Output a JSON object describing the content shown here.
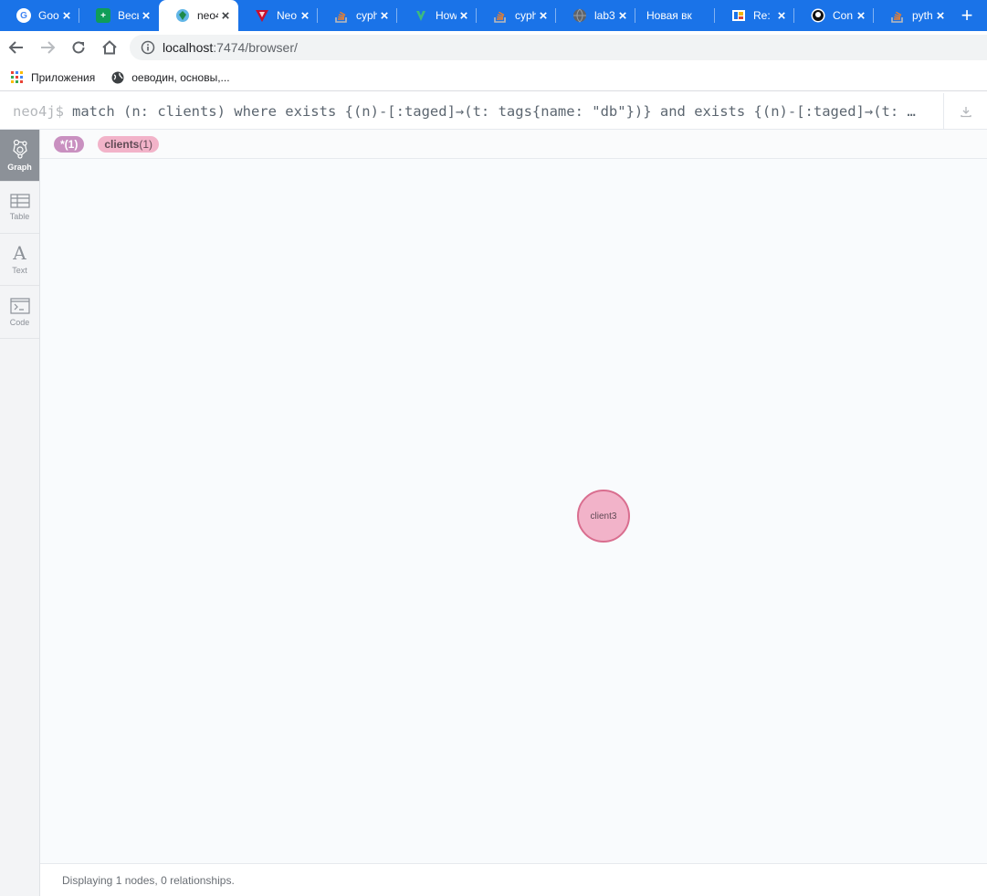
{
  "tabs": [
    {
      "title": "Goo",
      "favicon": "google-icon",
      "color": "#ffffff",
      "fg": "#4285f4",
      "glyph": "G"
    },
    {
      "title": "Весь",
      "favicon": "green-plus-icon",
      "color": "#0f9d58",
      "fg": "#ffffff",
      "glyph": "+"
    },
    {
      "title": "neo4",
      "favicon": "neo4j-browser-icon",
      "color": "#62b6e7",
      "fg": "#1e6b3a",
      "glyph": "◆",
      "active": true
    },
    {
      "title": "Neo",
      "favicon": "neo4j-triangle-icon",
      "color": "#c8102e",
      "fg": "#ffffff",
      "glyph": "▼"
    },
    {
      "title": "cyph",
      "favicon": "stackoverflow-icon",
      "color": "#f48024",
      "fg": "#ffffff",
      "glyph": "≡"
    },
    {
      "title": "How",
      "favicon": "green-leaf-icon",
      "color": "#3dba7e",
      "fg": "#ffffff",
      "glyph": "✓"
    },
    {
      "title": "cyph",
      "favicon": "stackoverflow-icon",
      "color": "#f48024",
      "fg": "#ffffff",
      "glyph": "≡"
    },
    {
      "title": "lab3",
      "favicon": "globe-icon",
      "color": "#5f6368",
      "fg": "#ffffff",
      "glyph": "◍"
    },
    {
      "title": "Новая вк",
      "favicon": "",
      "color": "",
      "fg": "",
      "glyph": ""
    },
    {
      "title": "Re: I",
      "favicon": "mail-icon",
      "color": "#ffffff",
      "fg": "#1a73e8",
      "glyph": "✉"
    },
    {
      "title": "Con",
      "favicon": "github-icon",
      "color": "#ffffff",
      "fg": "#000000",
      "glyph": "●"
    },
    {
      "title": "pyth",
      "favicon": "stackoverflow-icon",
      "color": "#f48024",
      "fg": "#ffffff",
      "glyph": "≡"
    }
  ],
  "address": {
    "host": "localhost",
    "path": ":7474/browser/"
  },
  "bookmarks": [
    {
      "label": "Приложения",
      "icon": "apps-grid-icon"
    },
    {
      "label": "оеводин, основы,...",
      "icon": "globe-icon"
    }
  ],
  "editor": {
    "prompt": "neo4j$",
    "query": "match (n: clients) where exists {(n)-[:taged]→(t: tags{name: \"db\"})} and exists {(n)-[:taged]→(t: …"
  },
  "sidebar": [
    {
      "label": "Graph",
      "icon": "graph-icon",
      "active": true
    },
    {
      "label": "Table",
      "icon": "table-icon"
    },
    {
      "label": "Text",
      "icon": "text-icon"
    },
    {
      "label": "Code",
      "icon": "code-icon"
    }
  ],
  "labels": [
    {
      "name": "*",
      "count": "(1)"
    },
    {
      "name": "clients",
      "count": "(1)"
    }
  ],
  "nodes": [
    {
      "caption": "client3"
    }
  ],
  "status": "Displaying 1 nodes, 0 relationships.",
  "colors": {
    "tabstrip": "#1a73e8",
    "node_fill": "#f2b3c9",
    "node_border": "#d96e8f",
    "pill_all": "#c990c0"
  }
}
